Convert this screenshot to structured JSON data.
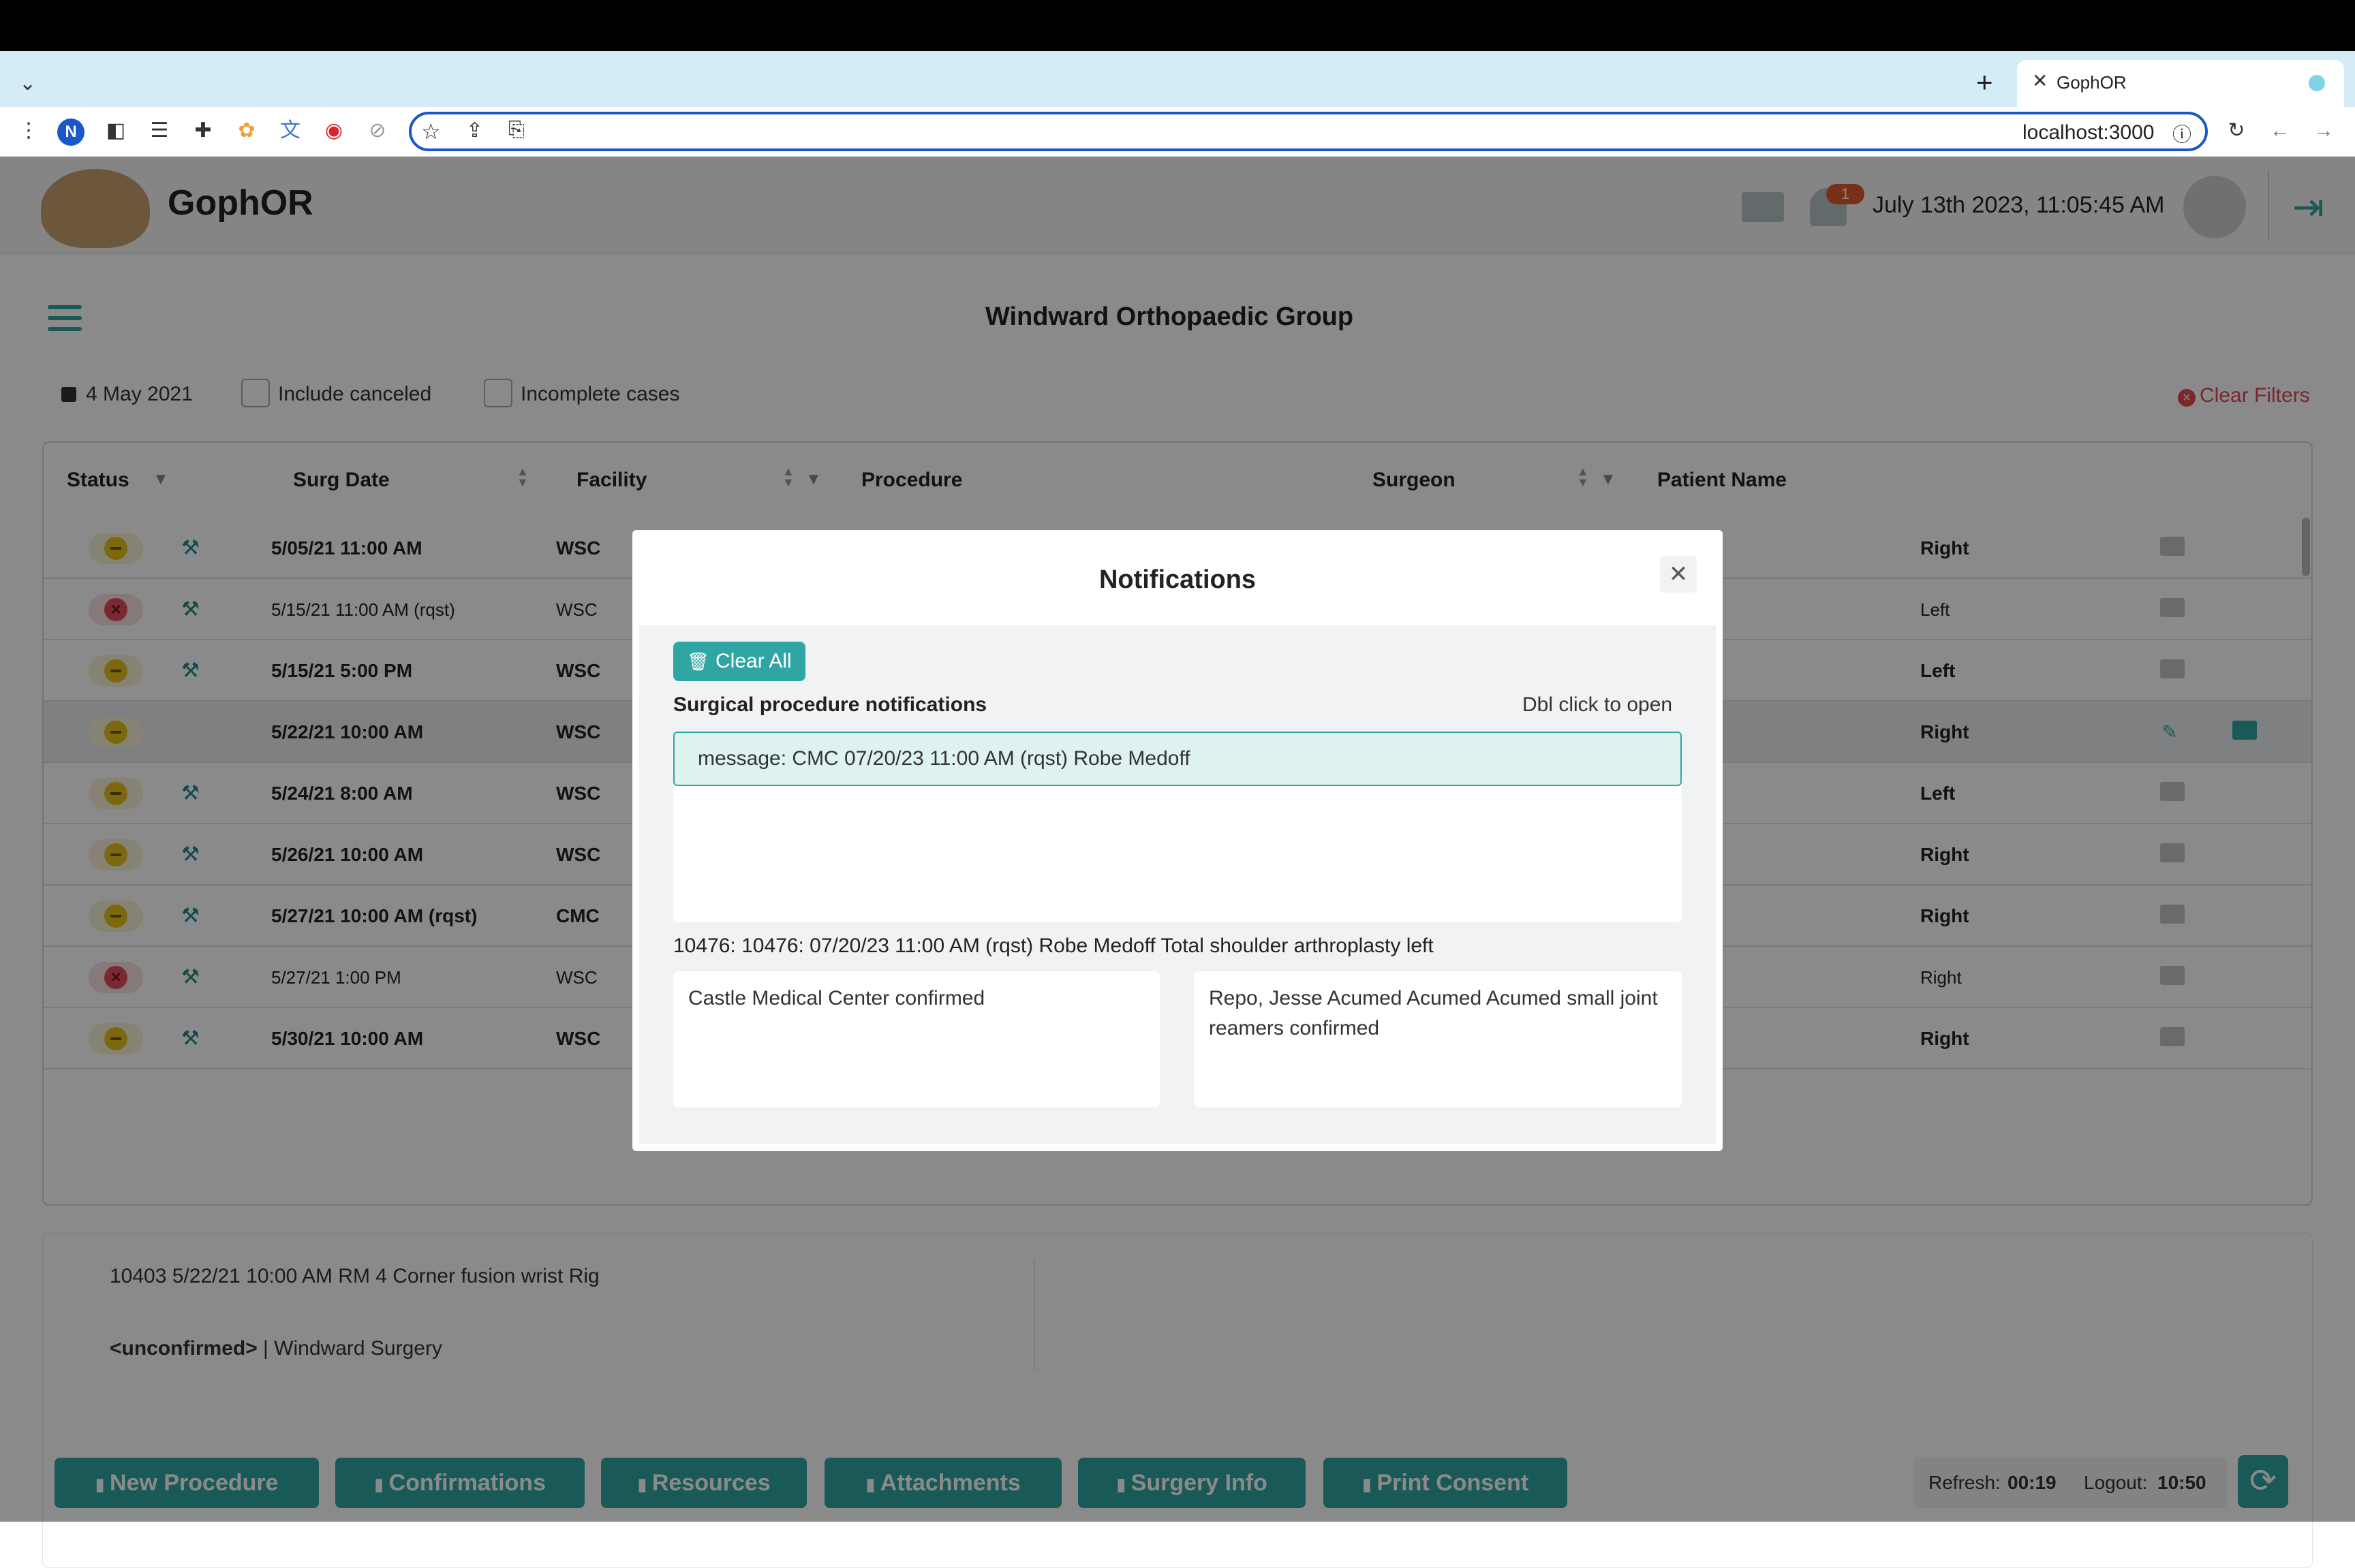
{
  "browser": {
    "tab_title": "GophOR",
    "url": "localhost:3000",
    "profile_initial": "N"
  },
  "app": {
    "brand": "GophOR",
    "datetime": "July 13th 2023, 11:05:45 AM",
    "bell_count": "1",
    "page_title": "Windward Orthopaedic Group",
    "date_filter": "4 May 2021",
    "include_canceled_label": "Include canceled",
    "incomplete_cases_label": "Incomplete cases",
    "clear_filters_label": "Clear Filters"
  },
  "table": {
    "columns": [
      "Status",
      "Surg Date",
      "Facility",
      "Procedure",
      "Surgeon",
      "Patient Name"
    ],
    "rows": [
      {
        "status": "pending",
        "date": "5/05/21 11:00 AM",
        "facility": "WSC",
        "side": "Right",
        "bold": true
      },
      {
        "status": "canceled",
        "date": "5/15/21 11:00 AM (rqst)",
        "facility": "WSC",
        "side": "Left",
        "bold": false
      },
      {
        "status": "pending",
        "date": "5/15/21 5:00 PM",
        "facility": "WSC",
        "side": "Left",
        "bold": true
      },
      {
        "status": "pending",
        "date": "5/22/21 10:00 AM",
        "facility": "WSC",
        "side": "Right",
        "bold": true
      },
      {
        "status": "pending",
        "date": "5/24/21 8:00 AM",
        "facility": "WSC",
        "side": "Left",
        "bold": true
      },
      {
        "status": "pending",
        "date": "5/26/21 10:00 AM",
        "facility": "WSC",
        "side": "Right",
        "bold": true
      },
      {
        "status": "pending",
        "date": "5/27/21 10:00 AM (rqst)",
        "facility": "CMC",
        "side": "Right",
        "bold": true
      },
      {
        "status": "canceled",
        "date": "5/27/21 1:00 PM",
        "facility": "WSC",
        "side": "Right",
        "bold": false
      },
      {
        "status": "pending",
        "date": "5/30/21 10:00 AM",
        "facility": "WSC",
        "side": "Right",
        "bold": true
      }
    ]
  },
  "details": {
    "line1": "10403 5/22/21 10:00 AM RM 4 Corner fusion wrist Rig",
    "line2_bold": "<unconfirmed>",
    "line2_rest": " | Windward Surgery"
  },
  "footer": {
    "buttons": [
      "New Procedure",
      "Confirmations",
      "Resources",
      "Attachments",
      "Surgery Info",
      "Print Consent"
    ],
    "refresh_label": "Refresh:",
    "refresh_value": "00:19",
    "logout_label": "Logout:",
    "logout_value": "10:50"
  },
  "modal": {
    "title": "Notifications",
    "clear_all": "Clear All",
    "section_title": "Surgical procedure notifications",
    "hint": "Dbl click to open",
    "message": "message: CMC 07/20/23 11:00 AM (rqst) Robe Medoff",
    "detail_line": "10476: 10476: 07/20/23 11:00 AM (rqst) Robe Medoff Total shoulder arthroplasty left",
    "card_left": "Castle Medical Center confirmed",
    "card_right": "Repo, Jesse Acumed Acumed Acumed small joint reamers confirmed"
  },
  "colors": {
    "accent": "#2fa6a3",
    "omnibox_border": "#1a57c9",
    "clear_filters": "#e0484f",
    "pending": "#e6c21c",
    "canceled": "#e24b5b"
  }
}
